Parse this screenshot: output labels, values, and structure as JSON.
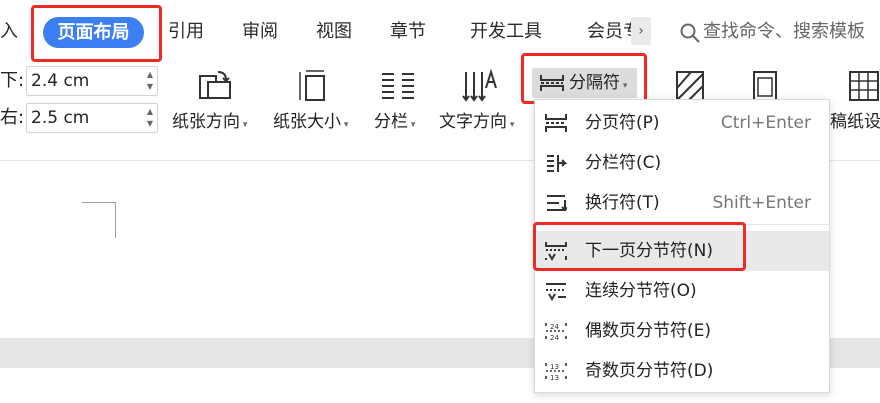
{
  "tabs": [
    {
      "label": "插入",
      "visible": "入"
    },
    {
      "label": "页面布局"
    },
    {
      "label": "引用"
    },
    {
      "label": "审阅"
    },
    {
      "label": "视图"
    },
    {
      "label": "章节"
    },
    {
      "label": "开发工具"
    },
    {
      "label": "会员专享",
      "visible": "会员专"
    }
  ],
  "more_tabs_glyph": "›",
  "search": {
    "text": "查找命令、搜索模板"
  },
  "margins": {
    "bottom": {
      "label": "下:",
      "value": "2.4 cm"
    },
    "right": {
      "label": "右:",
      "value": "2.5 cm"
    }
  },
  "ribbon": {
    "paper_orientation": "纸张方向",
    "paper_size": "纸张大小",
    "columns": "分栏",
    "text_direction": "文字方向",
    "separator": "分隔符",
    "manuscript": "稿纸设"
  },
  "separator_menu": {
    "items": [
      {
        "label": "分页符(P)",
        "shortcut": "Ctrl+Enter"
      },
      {
        "label": "分栏符(C)",
        "shortcut": ""
      },
      {
        "label": "换行符(T)",
        "shortcut": "Shift+Enter"
      },
      {
        "label": "下一页分节符(N)",
        "shortcut": ""
      },
      {
        "label": "连续分节符(O)",
        "shortcut": ""
      },
      {
        "label": "偶数页分节符(E)",
        "shortcut": ""
      },
      {
        "label": "奇数页分节符(D)",
        "shortcut": ""
      }
    ],
    "highlighted": "下一页分节符(N)"
  },
  "colors": {
    "accent": "#3b7ff2",
    "highlight_border": "#f02a22"
  }
}
